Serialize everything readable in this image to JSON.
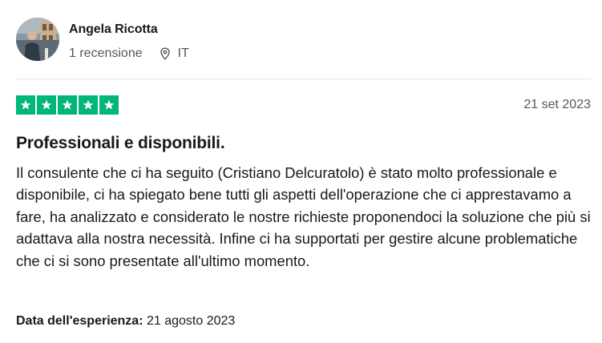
{
  "consumer": {
    "name": "Angela Ricotta",
    "reviews_count": "1 recensione",
    "country": "IT",
    "avatar_icon": "user-photo",
    "location_icon": "map-pin-icon"
  },
  "review": {
    "rating": 5,
    "max_rating": 5,
    "star_color": "#00b67a",
    "date": "21 set 2023",
    "title": "Professionali e disponibili.",
    "text": "Il consulente che ci ha seguito (Cristiano Delcuratolo) è stato molto professionale e disponibile, ci ha spiegato bene tutti gli aspetti dell'operazione che ci apprestavamo a fare, ha analizzato e considerato le nostre richieste proponendoci la soluzione che più si adattava alla nostra necessità. Infine ci ha supportati per gestire alcune problematiche che ci si sono presentate all'ultimo momento.",
    "experience_label": "Data dell'esperienza:",
    "experience_date": "21 agosto 2023"
  }
}
